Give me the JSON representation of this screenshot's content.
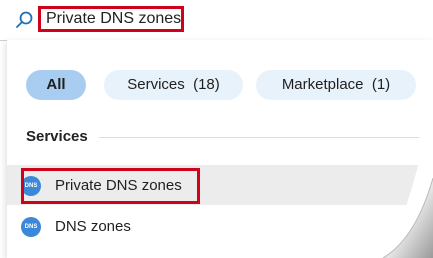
{
  "search": {
    "value": "Private DNS zones"
  },
  "filters": {
    "all": "All",
    "services": "Services  (18)",
    "marketplace": "Marketplace  (1)"
  },
  "section": {
    "heading": "Services"
  },
  "results": [
    {
      "icon_text": "DNS",
      "label": "Private DNS zones"
    },
    {
      "icon_text": "DNS",
      "label": "DNS zones"
    }
  ],
  "colors": {
    "highlight": "#d0021b",
    "pill_active": "#a9cdf0",
    "pill": "#e8f2fb",
    "icon": "#3b88d8"
  },
  "icons": {
    "search": "search-icon",
    "result": "dns-zone-icon"
  }
}
